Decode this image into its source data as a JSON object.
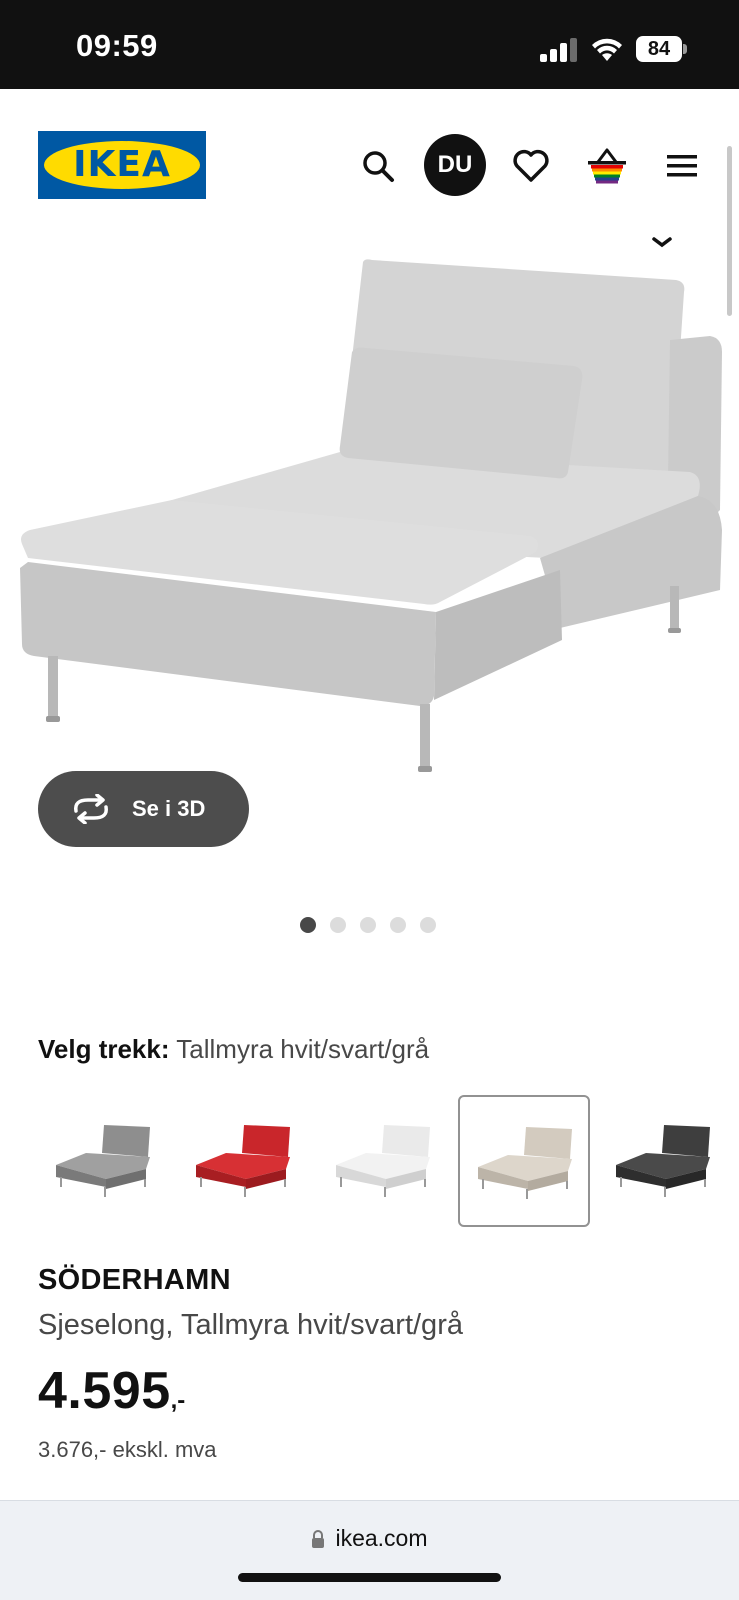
{
  "status_bar": {
    "time": "09:59",
    "battery": "84"
  },
  "header": {
    "logo_text": "IKEA",
    "user_initials": "DU",
    "icons": [
      "search-icon",
      "user-icon",
      "heart-icon",
      "cart-icon",
      "menu-icon"
    ]
  },
  "gallery": {
    "view_3d_label": "Se i 3D",
    "slide_count": 5,
    "active_slide": 1
  },
  "variant": {
    "label": "Velg trekk:",
    "value": "Tallmyra hvit/svart/grå",
    "swatches": [
      {
        "color": "#8e8e8e",
        "selected": false
      },
      {
        "color": "#c9262b",
        "selected": false
      },
      {
        "color": "#efefef",
        "selected": false
      },
      {
        "color": "#d6cfc4",
        "selected": true
      },
      {
        "color": "#3e3e3e",
        "selected": false
      }
    ]
  },
  "product": {
    "name": "SÖDERHAMN",
    "description": "Sjeselong, Tallmyra hvit/svart/grå",
    "price_integer": "4.595",
    "price_decimal": ",-",
    "price_ex_vat": "3.676,- ekskl. mva"
  },
  "browser": {
    "url": "ikea.com"
  },
  "colors": {
    "ikea_blue": "#0058a3",
    "ikea_yellow": "#ffdb00",
    "button_dark": "#4d4d4d"
  }
}
